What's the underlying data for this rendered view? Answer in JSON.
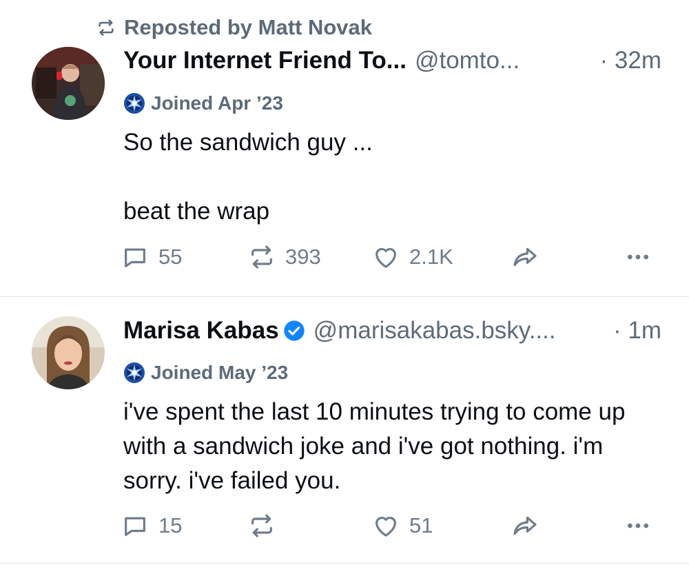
{
  "colors": {
    "text": "#0b0f14",
    "muted": "#5c6b7a",
    "icon": "#6f7c8b",
    "divider": "#e3e8ee",
    "verified": "#1185fe"
  },
  "posts": [
    {
      "repost_label": "Reposted by Matt Novak",
      "display_name": "Your Internet Friend To...",
      "verified": false,
      "handle": "@tomto...",
      "time": "· 32m",
      "joined": "Joined Apr ’23",
      "text": "So the sandwich guy ...\n\nbeat the wrap",
      "counts": {
        "replies": "55",
        "reposts": "393",
        "likes": "2.1K"
      },
      "icons": {
        "reply": "reply-icon",
        "repost": "repost-icon",
        "like": "heart-icon",
        "share": "share-icon",
        "more": "more-icon"
      }
    },
    {
      "display_name": "Marisa Kabas",
      "verified": true,
      "handle": "@marisakabas.bsky....",
      "time": "· 1m",
      "joined": "Joined May ’23",
      "text": "i've spent the last 10 minutes trying to come up with a sandwich joke and i've got nothing. i'm sorry. i've failed you.",
      "counts": {
        "replies": "15",
        "reposts": "",
        "likes": "51"
      },
      "icons": {
        "reply": "reply-icon",
        "repost": "repost-icon",
        "like": "heart-icon",
        "share": "share-icon",
        "more": "more-icon"
      }
    }
  ]
}
